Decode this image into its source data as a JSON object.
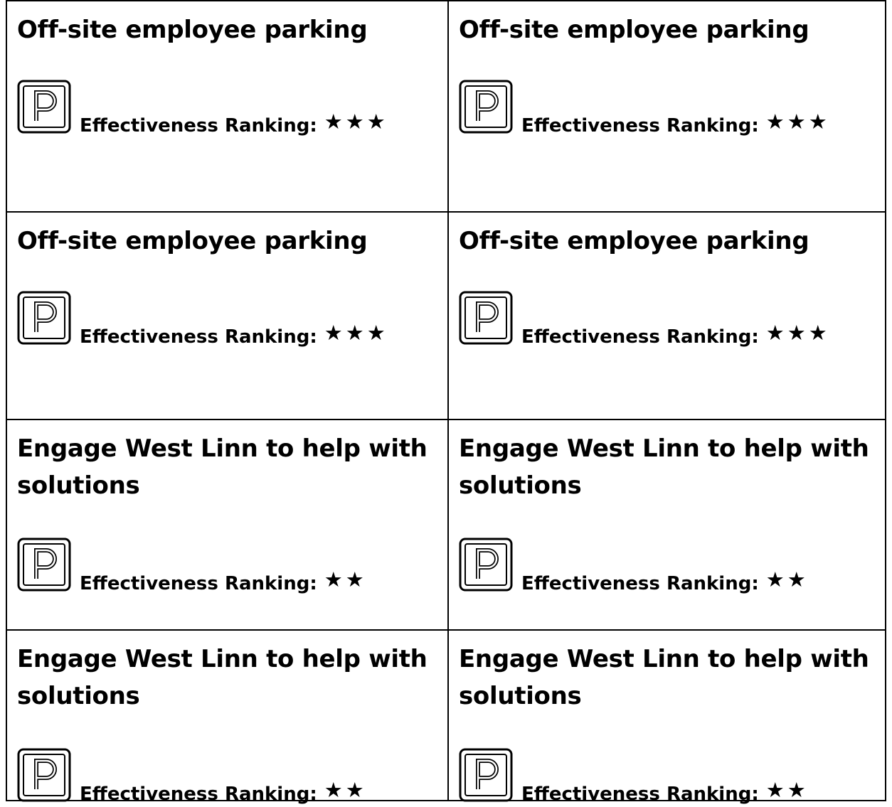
{
  "cards": [
    {
      "title": "Off-site employee parking",
      "ranking_label": "Effectiveness Ranking:",
      "rating": 3,
      "stars": "★★★",
      "icon": "parking-icon"
    },
    {
      "title": "Off-site employee parking",
      "ranking_label": "Effectiveness Ranking:",
      "rating": 3,
      "stars": "★★★",
      "icon": "parking-icon"
    },
    {
      "title": "Off-site employee parking",
      "ranking_label": "Effectiveness Ranking:",
      "rating": 3,
      "stars": "★★★",
      "icon": "parking-icon"
    },
    {
      "title": "Off-site employee parking",
      "ranking_label": "Effectiveness Ranking:",
      "rating": 3,
      "stars": "★★★",
      "icon": "parking-icon"
    },
    {
      "title": "Engage West Linn to help with solutions",
      "ranking_label": "Effectiveness Ranking:",
      "rating": 2,
      "stars": "★★",
      "icon": "parking-icon"
    },
    {
      "title": "Engage West Linn to help with solutions",
      "ranking_label": "Effectiveness Ranking:",
      "rating": 2,
      "stars": "★★",
      "icon": "parking-icon"
    },
    {
      "title": "Engage West Linn to help with solutions",
      "ranking_label": "Effectiveness Ranking:",
      "rating": 2,
      "stars": "★★",
      "icon": "parking-icon"
    },
    {
      "title": "Engage West Linn to help with solutions",
      "ranking_label": "Effectiveness Ranking:",
      "rating": 2,
      "stars": "★★",
      "icon": "parking-icon"
    }
  ]
}
